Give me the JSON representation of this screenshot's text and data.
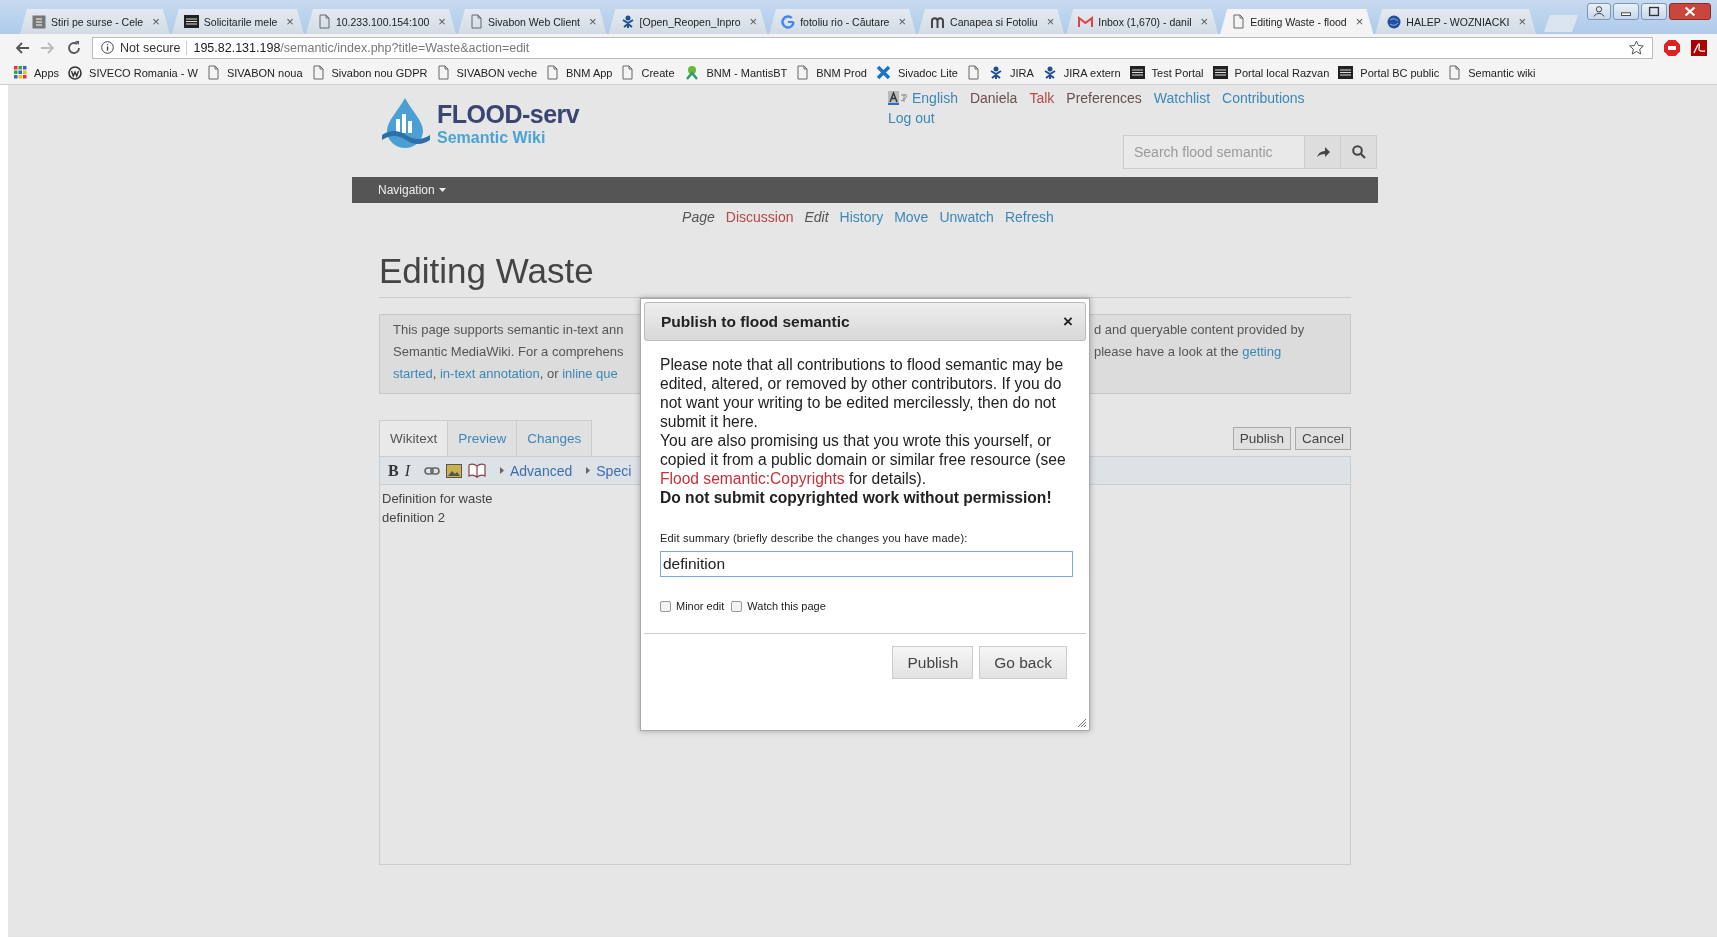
{
  "browser": {
    "tabs": [
      {
        "title": "Stiri pe surse - Cele",
        "kind": "square",
        "selected": false
      },
      {
        "title": "Solicitarile mele",
        "kind": "dark",
        "selected": false
      },
      {
        "title": "10.233.100.154:100",
        "kind": "page",
        "selected": false
      },
      {
        "title": "Sivabon Web Client",
        "kind": "page",
        "selected": false
      },
      {
        "title": "[Open_Reopen_Inpro",
        "kind": "bug",
        "selected": false
      },
      {
        "title": "fotoliu rio - Căutare",
        "kind": "google",
        "selected": false
      },
      {
        "title": "Canapea si Fotoliu",
        "kind": "letter",
        "selected": false
      },
      {
        "title": "Inbox (1,670) - danil",
        "kind": "mail",
        "selected": false
      },
      {
        "title": "Editing Waste - flood",
        "kind": "page",
        "selected": true
      },
      {
        "title": "HALEP - WOZNIACKI",
        "kind": "globe",
        "selected": false
      }
    ],
    "tab_close": "×",
    "not_secure": "Not secure",
    "url_host": "195.82.131.198",
    "url_path": "/semantic/index.php?title=Waste&action=edit",
    "bookmarks": [
      {
        "label": "Apps",
        "kind": "apps"
      },
      {
        "label": "SIVECO Romania - W",
        "kind": "w"
      },
      {
        "label": "SIVABON noua",
        "kind": "page"
      },
      {
        "label": "Sivabon nou GDPR",
        "kind": "page"
      },
      {
        "label": "SIVABON veche",
        "kind": "page"
      },
      {
        "label": "BNM App",
        "kind": "page"
      },
      {
        "label": "Create",
        "kind": "page"
      },
      {
        "label": "BNM - MantisBT",
        "kind": "mantis"
      },
      {
        "label": "BNM Prod",
        "kind": "page"
      },
      {
        "label": "Sivadoc Lite",
        "kind": "cross"
      },
      {
        "kind": "page"
      },
      {
        "label": "JIRA",
        "kind": "bug"
      },
      {
        "label": "JIRA extern",
        "kind": "bug"
      },
      {
        "label": "Test Portal",
        "kind": "dark"
      },
      {
        "label": "Portal local Razvan",
        "kind": "dark"
      },
      {
        "label": "Portal BC public",
        "kind": "dark"
      },
      {
        "label": "Semantic wiki",
        "kind": "page"
      }
    ]
  },
  "header": {
    "logo_title": "FLOOD-serv",
    "logo_subtitle": "Semantic Wiki",
    "user_links": [
      {
        "label": "English",
        "kind": "language"
      },
      {
        "label": "Daniela",
        "kind": "visited"
      },
      {
        "label": "Talk",
        "kind": "new"
      },
      {
        "label": "Preferences",
        "kind": "visited"
      },
      {
        "label": "Watchlist",
        "kind": "link"
      },
      {
        "label": "Contributions",
        "kind": "link"
      },
      {
        "label": "Log out",
        "kind": "link"
      }
    ],
    "search": {
      "placeholder": "Search flood semantic"
    }
  },
  "navbar": {
    "label": "Navigation"
  },
  "actions": [
    {
      "label": "Page",
      "selected": true,
      "new": false
    },
    {
      "label": "Discussion",
      "selected": false,
      "new": true
    },
    {
      "label": "Edit",
      "selected": true,
      "new": false
    },
    {
      "label": "History",
      "selected": false,
      "new": false
    },
    {
      "label": "Move",
      "selected": false,
      "new": false
    },
    {
      "label": "Unwatch",
      "selected": false,
      "new": false
    },
    {
      "label": "Refresh",
      "selected": false,
      "new": false
    }
  ],
  "heading": "Editing Waste",
  "info_box": {
    "left_lines": [
      [
        {
          "text": "This page supports semantic in-text ann",
          "link": false
        }
      ],
      [
        {
          "text": "Semantic MediaWiki. For a comprehens",
          "link": false
        }
      ],
      [
        {
          "text": "started",
          "link": true
        },
        {
          "text": ", ",
          "link": false
        },
        {
          "text": "in-text annotation",
          "link": true
        },
        {
          "text": ", or ",
          "link": false
        },
        {
          "text": "inline que",
          "link": true
        }
      ]
    ],
    "right_lines": [
      [
        {
          "text": "d and queryable content provided by",
          "link": false
        }
      ],
      [
        {
          "text": "please have a look at the ",
          "link": false
        },
        {
          "text": "getting",
          "link": true
        }
      ]
    ]
  },
  "editor": {
    "tabs": [
      {
        "label": "Wikitext",
        "selected": true
      },
      {
        "label": "Preview",
        "selected": false
      },
      {
        "label": "Changes",
        "selected": false
      }
    ],
    "buttons": [
      "Publish",
      "Cancel"
    ],
    "toolbar": [
      {
        "kind": "bold",
        "label": "B"
      },
      {
        "kind": "italic",
        "label": "I"
      },
      {
        "kind": "link"
      },
      {
        "kind": "image"
      },
      {
        "kind": "reference"
      },
      {
        "kind": "section",
        "label": "Advanced"
      },
      {
        "kind": "section",
        "label": "Speci"
      }
    ],
    "text_lines": [
      "Definition for waste",
      "definition 2"
    ]
  },
  "dialog": {
    "title": "Publish to flood semantic",
    "close": "×",
    "paragraph_1": "Please note that all contributions to flood semantic may be edited, altered, or removed by other contributors. If you do not want your writing to be edited mercilessly, then do not submit it here.",
    "paragraph_2": [
      {
        "text": "You are also promising us that you wrote this yourself, or copied it from a public domain or similar free resource (see ",
        "link": false
      },
      {
        "text": "Flood semantic:Copyrights",
        "link": true
      },
      {
        "text": " for details).",
        "link": false
      }
    ],
    "warning": "Do not submit copyrighted work without permission!",
    "summary_label": "Edit summary (briefly describe the changes you have made):",
    "summary_value": "definition",
    "checkboxes": [
      {
        "label": "Minor edit",
        "checked": false
      },
      {
        "label": "Watch this page",
        "checked": false
      }
    ],
    "buttons": [
      "Publish",
      "Go back"
    ]
  }
}
